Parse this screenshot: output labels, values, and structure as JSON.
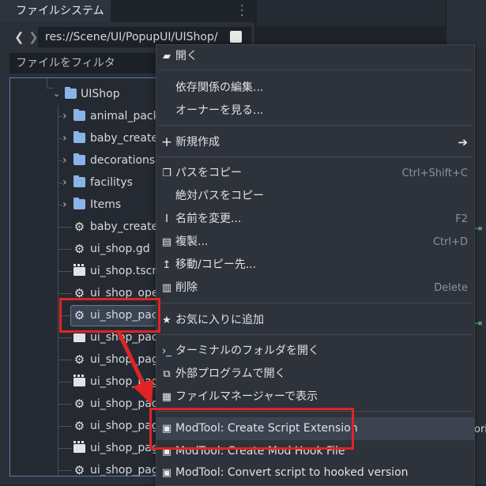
{
  "filesystem": {
    "tab_title": "ファイルシステム",
    "nav_back": "❮",
    "nav_forward": "❯",
    "path": "res://Scene/UI/PopupUI/UIShop/",
    "filter_placeholder": "ファイルをフィルタ"
  },
  "tree": {
    "parent_folder": "UIShop",
    "items": [
      {
        "label": "animal_pack",
        "icon": "folder-icon",
        "expandable": true
      },
      {
        "label": "baby_creater",
        "icon": "folder-icon",
        "expandable": true
      },
      {
        "label": "decorations",
        "icon": "folder-icon",
        "expandable": true
      },
      {
        "label": "facilitys",
        "icon": "folder-icon",
        "expandable": true
      },
      {
        "label": "Items",
        "icon": "folder-icon",
        "expandable": true
      },
      {
        "label": "baby_creater",
        "icon": "gear-icon",
        "expandable": false
      },
      {
        "label": "ui_shop.gd",
        "icon": "gear-icon",
        "expandable": false
      },
      {
        "label": "ui_shop.tscn",
        "icon": "clapperboard-icon",
        "expandable": false
      },
      {
        "label": "ui_shop_ope",
        "icon": "gear-icon",
        "expandable": false
      },
      {
        "label": "ui_shop_pack",
        "icon": "gear-icon",
        "expandable": false,
        "selected": true
      },
      {
        "label": "ui_shop_pack",
        "icon": "clapperboard-icon",
        "expandable": false
      },
      {
        "label": "ui_shop_pag",
        "icon": "gear-icon",
        "expandable": false
      },
      {
        "label": "ui_shop_pag",
        "icon": "clapperboard-icon",
        "expandable": false
      },
      {
        "label": "ui_shop_pag",
        "icon": "gear-icon",
        "expandable": false
      },
      {
        "label": "ui_shop_pag",
        "icon": "gear-icon",
        "expandable": false
      },
      {
        "label": "ui_shop_pag",
        "icon": "clapperboard-icon",
        "expandable": false
      },
      {
        "label": "ui_shop_pag",
        "icon": "gear-icon",
        "expandable": false
      }
    ]
  },
  "context_menu": {
    "open": "開く",
    "edit_dependencies": "依存関係の編集...",
    "view_owners": "オーナーを見る...",
    "new": "新規作成",
    "copy_path": "パスをコピー",
    "copy_path_shortcut": "Ctrl+Shift+C",
    "copy_absolute_path": "絶対パスをコピー",
    "rename": "名前を変更...",
    "rename_shortcut": "F2",
    "duplicate": "複製...",
    "duplicate_shortcut": "Ctrl+D",
    "move_copy": "移動/コピー先...",
    "delete": "削除",
    "delete_shortcut": "Delete",
    "add_favorite": "お気に入りに追加",
    "open_terminal": "ターミナルのフォルダを開く",
    "open_external": "外部プログラムで開く",
    "show_file_manager": "ファイルマネージャーで表示",
    "modtool_create_extension": "ModTool: Create Script Extension",
    "modtool_create_hook_file": "ModTool: Create Mod Hook File",
    "modtool_convert_script": "ModTool: Convert script to hooked version"
  },
  "right_pane": {
    "partial_text": "oric"
  },
  "colors": {
    "highlight_red": "#e02424",
    "accent_blue": "#8ab4e8"
  }
}
